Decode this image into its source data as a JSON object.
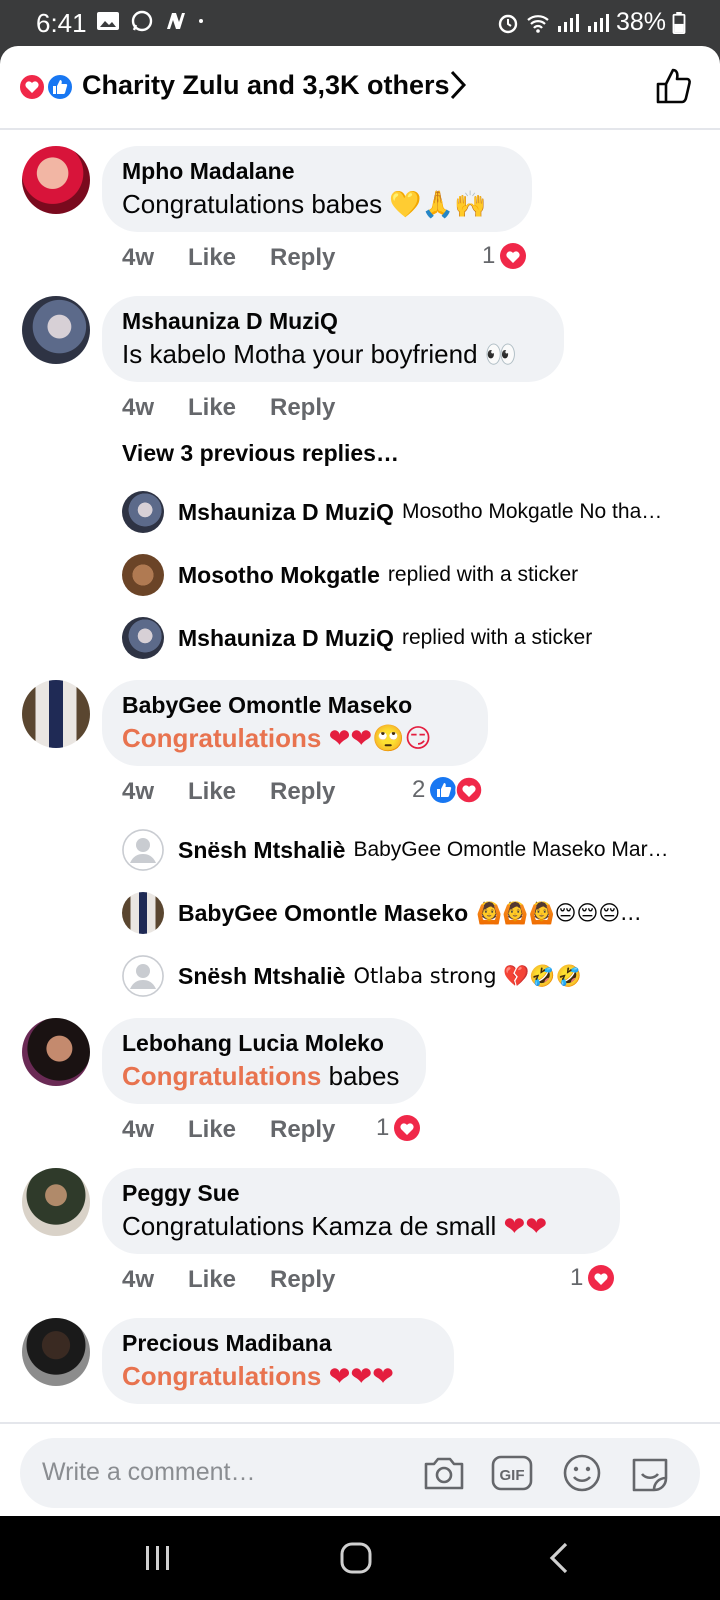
{
  "status_bar": {
    "time": "6:41",
    "battery": "38%"
  },
  "reactions_header": {
    "label": "Charity Zulu and 3,3K others"
  },
  "comments": [
    {
      "name": "Mpho Madalane",
      "text": "Congratulations babes",
      "emoji": "💛🙏🙌",
      "time": "4w",
      "like": "Like",
      "reply": "Reply",
      "reaction_count": "1"
    },
    {
      "name": "Mshauniza D MuziQ",
      "text": "Is kabelo Motha your boyfriend",
      "emoji": "👀",
      "time": "4w",
      "like": "Like",
      "reply": "Reply",
      "view_previous": "View 3 previous replies…",
      "replies": [
        {
          "name": "Mshauniza D MuziQ",
          "text": "Mosotho Mokgatle No tha…"
        },
        {
          "name": "Mosotho Mokgatle",
          "text": "replied with a sticker"
        },
        {
          "name": "Mshauniza D MuziQ",
          "text": "replied with a sticker"
        }
      ]
    },
    {
      "name": "BabyGee Omontle Maseko",
      "highlight": "Congratulations",
      "emoji": "❤❤🙄😏",
      "time": "4w",
      "like": "Like",
      "reply": "Reply",
      "reaction_count": "2",
      "replies": [
        {
          "name": "Snësh Mtshaliè",
          "text": "BabyGee Omontle Maseko Mar…"
        },
        {
          "name": "BabyGee Omontle Maseko",
          "text": "🙆🙆🙆😔😔😔…"
        },
        {
          "name": "Snësh Mtshaliè",
          "text": "Otlaba strong 💔🤣🤣"
        }
      ]
    },
    {
      "name": "Lebohang Lucia Moleko",
      "highlight": "Congratulations",
      "text": "babes",
      "time": "4w",
      "like": "Like",
      "reply": "Reply",
      "reaction_count": "1"
    },
    {
      "name": "Peggy Sue",
      "text": "Congratulations Kamza de small",
      "emoji": "❤❤",
      "time": "4w",
      "like": "Like",
      "reply": "Reply",
      "reaction_count": "1"
    },
    {
      "name": "Precious Madibana",
      "highlight": "Congratulations",
      "emoji": "❤❤❤"
    }
  ],
  "composer": {
    "placeholder": "Write a comment…"
  },
  "colors": {
    "link_highlight": "#e8734f",
    "love": "#e41e3f",
    "like_blue": "#1877f2"
  }
}
